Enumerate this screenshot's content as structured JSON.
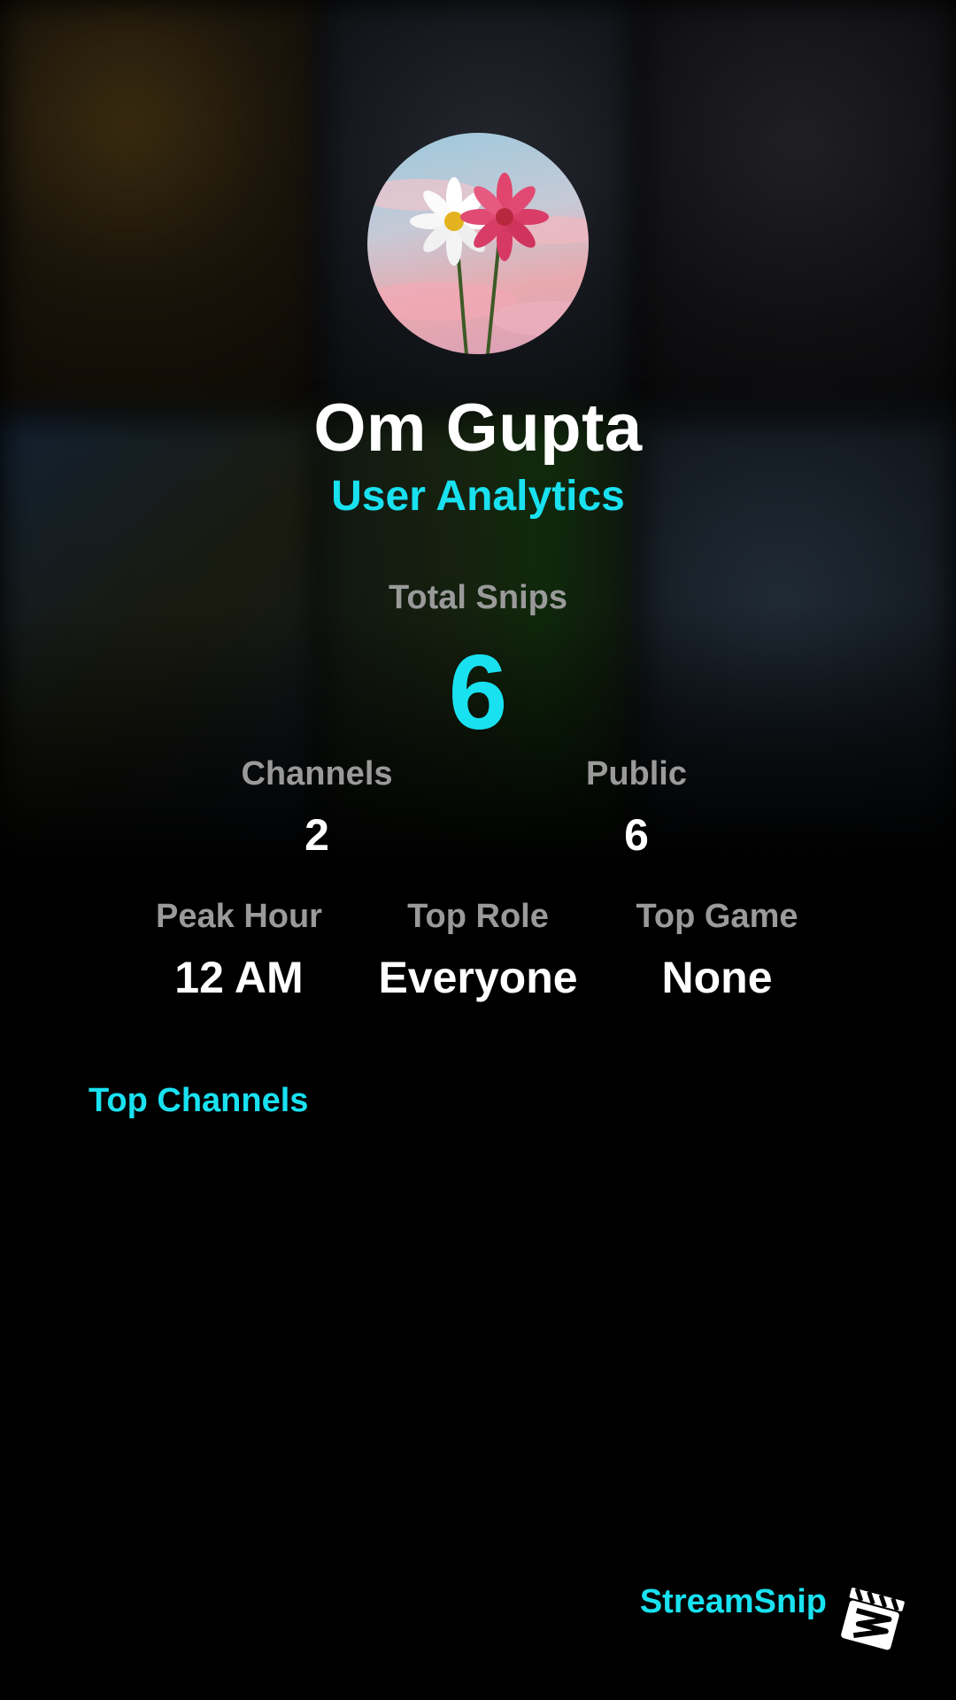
{
  "profile": {
    "name": "Om Gupta",
    "subtitle": "User Analytics"
  },
  "stats": {
    "total_label": "Total Snips",
    "total_value": "6",
    "channels_label": "Channels",
    "channels_value": "2",
    "public_label": "Public",
    "public_value": "6",
    "peak_hour_label": "Peak Hour",
    "peak_hour_value": "12 AM",
    "top_role_label": "Top Role",
    "top_role_value": "Everyone",
    "top_game_label": "Top Game",
    "top_game_value": "None"
  },
  "sections": {
    "top_channels_title": "Top Channels"
  },
  "branding": {
    "name": "StreamSnip",
    "logo_icon": "clapperboard-icon"
  },
  "colors": {
    "accent": "#19e1f0",
    "label_gray": "#9a9a9a",
    "background": "#000000"
  }
}
